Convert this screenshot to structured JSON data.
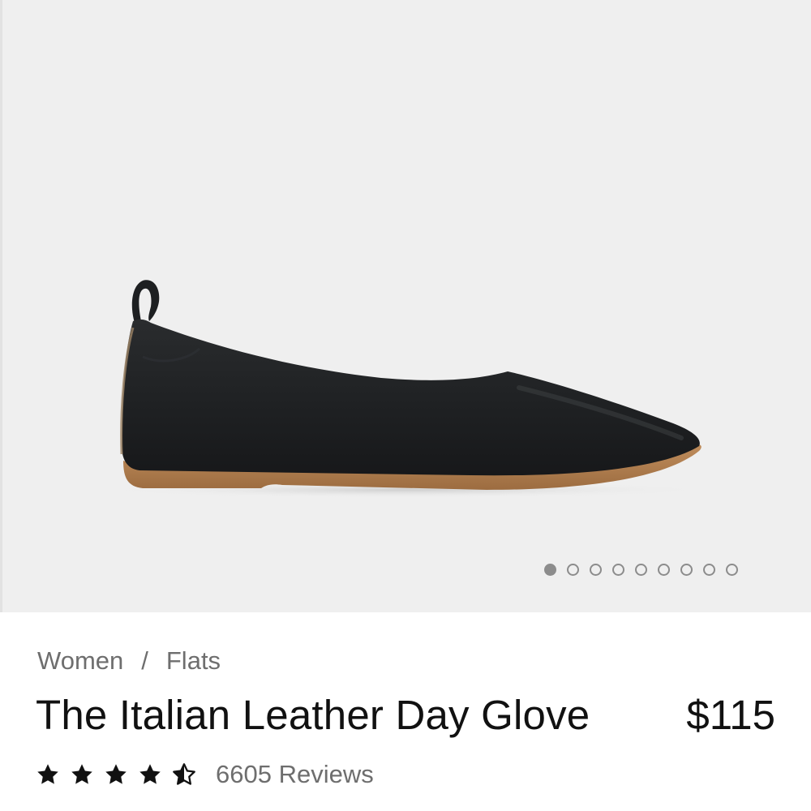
{
  "product": {
    "image_alt": "Black leather ballet flat shown in side profile",
    "carousel": {
      "total": 9,
      "active_index": 0
    },
    "breadcrumb": [
      "Women",
      "Flats"
    ],
    "breadcrumb_separator": "/",
    "title": "The Italian Leather Day Glove",
    "price": "$115",
    "rating": 4.5,
    "rating_max": 5,
    "reviews_text": "6605 Reviews"
  },
  "icons": {
    "star_full": "star-icon",
    "star_half": "star-half-icon"
  },
  "colors": {
    "hero_background": "#efefef",
    "shoe_leather": "#1f2123",
    "sole": "#b07d4f",
    "text_primary": "#111111",
    "text_secondary": "#6e6e6e",
    "dot": "#8c8c8c"
  }
}
